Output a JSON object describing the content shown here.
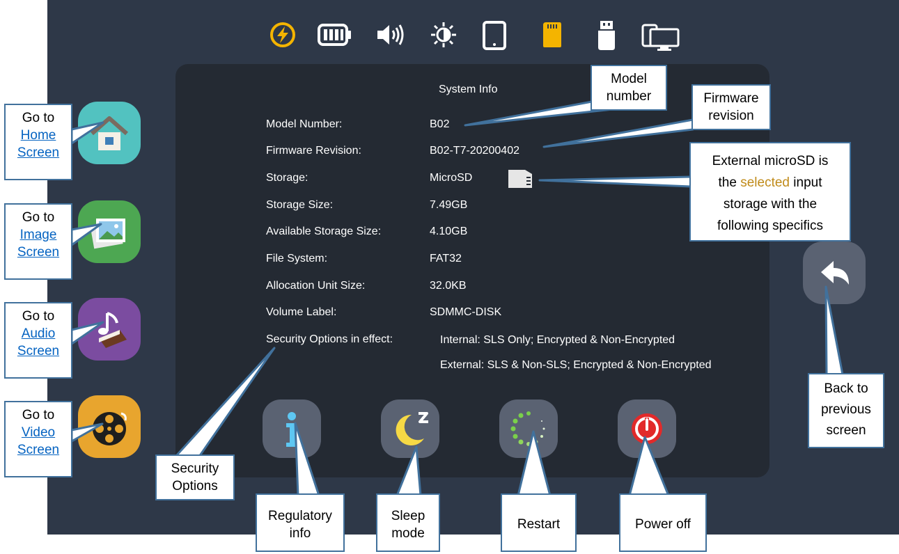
{
  "status_icons": [
    {
      "name": "power-icon",
      "color": "#f4b400"
    },
    {
      "name": "battery-icon",
      "color": "#ffffff"
    },
    {
      "name": "volume-icon",
      "color": "#ffffff"
    },
    {
      "name": "brightness-icon",
      "color": "#ffffff"
    },
    {
      "name": "tablet-icon",
      "color": "#ffffff"
    },
    {
      "name": "sd-card-icon",
      "color": "#f4b400"
    },
    {
      "name": "usb-drive-icon",
      "color": "#ffffff"
    },
    {
      "name": "display-icon",
      "color": "#ffffff"
    }
  ],
  "system_info": {
    "title": "System Info",
    "rows": [
      {
        "label": "Model Number:",
        "value": "B02"
      },
      {
        "label": "Firmware Revision:",
        "value": "B02-T7-20200402"
      },
      {
        "label": "Storage:",
        "value": "MicroSD"
      },
      {
        "label": "Storage Size:",
        "value": "7.49GB"
      },
      {
        "label": "Available Storage Size:",
        "value": "4.10GB"
      },
      {
        "label": "File System:",
        "value": "FAT32"
      },
      {
        "label": "Allocation Unit Size:",
        "value": "32.0KB"
      },
      {
        "label": "Volume Label:",
        "value": "SDMMC-DISK"
      },
      {
        "label": "Security Options in effect:",
        "value": "Internal: SLS Only; Encrypted & Non-Encrypted"
      }
    ],
    "extra_value": "External: SLS & Non-SLS; Encrypted & Non-Encrypted"
  },
  "callouts": {
    "home": {
      "prefix": "Go to",
      "link1": "Home",
      "link2": "Screen"
    },
    "image": {
      "prefix": "Go to",
      "link1": "Image",
      "link2": "Screen"
    },
    "audio": {
      "prefix": "Go to",
      "link1": "Audio",
      "link2": "Screen"
    },
    "video": {
      "prefix": "Go to",
      "link1": "Video",
      "link2": "Screen"
    },
    "model": {
      "line1": "Model",
      "line2": "number"
    },
    "firmware": {
      "line1": "Firmware",
      "line2": "revision"
    },
    "storage": {
      "line1": "External microSD is",
      "line2_pre": "the ",
      "line2_hl": "selected",
      "line2_post": " input",
      "line3": "storage with the",
      "line4": "following specifics"
    },
    "security": {
      "line1": "Security",
      "line2": "Options"
    },
    "regulatory": {
      "line1": "Regulatory",
      "line2": "info"
    },
    "sleep": {
      "line1": "Sleep",
      "line2": "mode"
    },
    "restart": {
      "line1": "Restart"
    },
    "power": {
      "line1": "Power off"
    },
    "back": {
      "line1": "Back to",
      "line2": "previous",
      "line3": "screen"
    }
  },
  "colors": {
    "screen_bg": "#2e3848",
    "panel_bg": "#242a33",
    "callout_border": "#41719c",
    "link": "#0563c1",
    "highlight": "#c08b1a"
  }
}
